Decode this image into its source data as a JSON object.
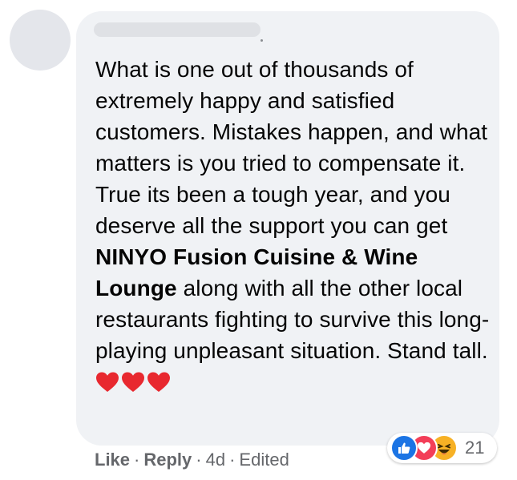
{
  "comment": {
    "text_part1": "What is one out of thousands of extremely happy and satisfied customers. Mistakes happen, and what matters is you tried to compensate it. True its been a tough year, and you deserve all the support you can get ",
    "mention": "NINYO Fusion Cuisine & Wine Lounge",
    "text_part2": " along with all the other local restaurants fighting to survive this long-playing unpleasant situation. Stand tall. ",
    "emoji_icons": [
      "red-heart-icon",
      "red-heart-icon",
      "red-heart-icon"
    ]
  },
  "actions": {
    "like_label": "Like",
    "reply_label": "Reply",
    "separator": "·",
    "time": "4d",
    "edited_label": "Edited"
  },
  "reactions": {
    "icons": [
      "like-reaction-icon",
      "love-reaction-icon",
      "haha-reaction-icon"
    ],
    "count": "21"
  },
  "colors": {
    "bubble": "#f0f2f5",
    "text": "#050505",
    "secondary_text": "#65676b",
    "like_blue": "#1b74e4",
    "love_red": "#f33e58",
    "haha_yellow": "#f7b125"
  }
}
